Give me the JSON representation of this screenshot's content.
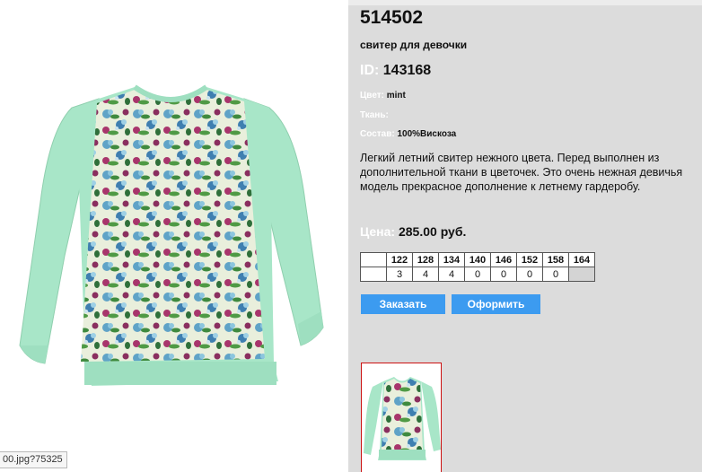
{
  "product": {
    "article": "514502",
    "subtitle": "свитер для девочки",
    "id_label": "ID:",
    "id_value": "143168",
    "color_label": "Цвет:",
    "color_value": "mint",
    "fabric_label": "Ткань:",
    "fabric_value": "",
    "composition_label": "Состав:",
    "composition_value": "100%Вискоза",
    "description": "Легкий летний свитер нежного цвета. Перед выполнен из дополнительной ткани в цветочек. Это очень нежная девичья модель прекрасное дополнение к летнему гардеробу.",
    "price_label": "Цена:",
    "price_value": "285.00 руб."
  },
  "sizes": {
    "header": [
      "",
      "122",
      "128",
      "134",
      "140",
      "146",
      "152",
      "158",
      "164"
    ],
    "quantities": [
      "",
      "3",
      "4",
      "4",
      "0",
      "0",
      "0",
      "0",
      ""
    ]
  },
  "buttons": {
    "order_label": "Заказать",
    "checkout_label": "Оформить"
  },
  "status_tooltip": "00.jpg?75325",
  "colors": {
    "accent": "#3c9bf0",
    "panel": "#dcdcdc",
    "sweater": "#a8e6c8"
  }
}
